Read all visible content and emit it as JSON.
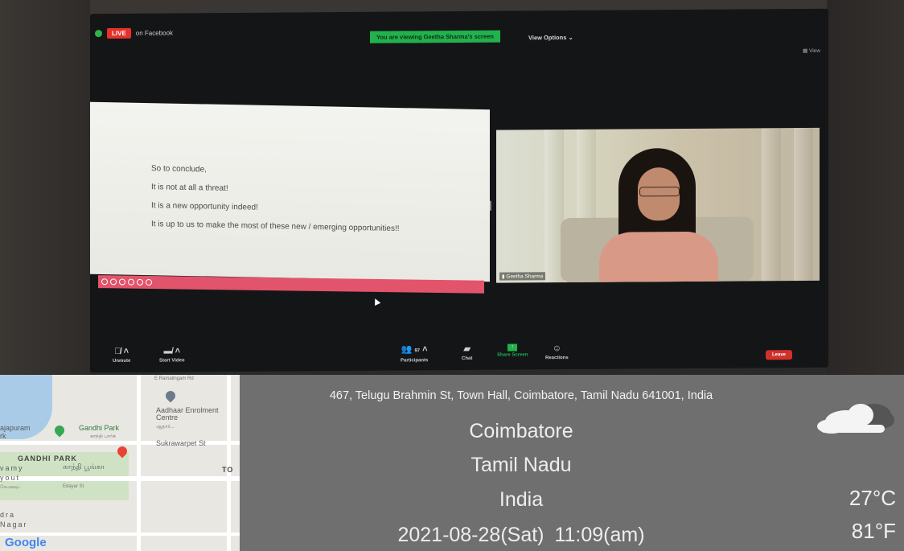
{
  "zoom": {
    "live_badge": "LIVE",
    "live_destination": "on Facebook",
    "viewing_banner": "You are viewing Geetha Sharma's screen",
    "view_options": "View Options",
    "view_button": "View",
    "slide_lines": [
      "So to conclude,",
      "It is not at all a threat!",
      "It is a new opportunity indeed!",
      "It is up to us to make the most of these new / emerging opportunities!!"
    ],
    "speaker_name": "Geetha Sharma",
    "controls": {
      "unmute": "Unmute",
      "start_video": "Start Video",
      "participants": "Participants",
      "participants_count": "97",
      "chat": "Chat",
      "share_screen": "Share Screen",
      "reactions": "Reactions",
      "leave": "Leave"
    }
  },
  "map": {
    "labels": {
      "ramalingam": "E Ramalingam Rd",
      "aadhaar": "Aadhaar Enrolment Centre",
      "aadhaar_ta": "ஆதார்...",
      "gandhi_park": "Gandhi Park",
      "gandhi_park_ta": "காந்தி பார்க்",
      "rajapuram": "ajapuram",
      "rk": "rk",
      "sukrawarpet": "Sukrawarpet St",
      "gandhi_park_area": "GANDHI PARK",
      "gandhi_park_area_ta": "காந்தி பூங்கா",
      "vamy": "vamy",
      "yout": "yout",
      "lay_ta": "லேஅவுட்",
      "dra": "dra",
      "nagar": "Nagar",
      "to": "TO",
      "edayar": "Edayar St",
      "google": "Google"
    }
  },
  "location": {
    "address": "467, Telugu Brahmin St, Town Hall, Coimbatore, Tamil Nadu 641001, India",
    "city": "Coimbatore",
    "state": "Tamil Nadu",
    "country": "India",
    "datetime": "2021-08-28(Sat)  11:09(am)",
    "temp_c": "27°C",
    "temp_f": "81°F"
  },
  "colors": {
    "live_red": "#e4312b",
    "banner_green": "#23b14d",
    "slide_toolbar": "#e2546b",
    "overlay_gray": "#6f6f6f"
  }
}
